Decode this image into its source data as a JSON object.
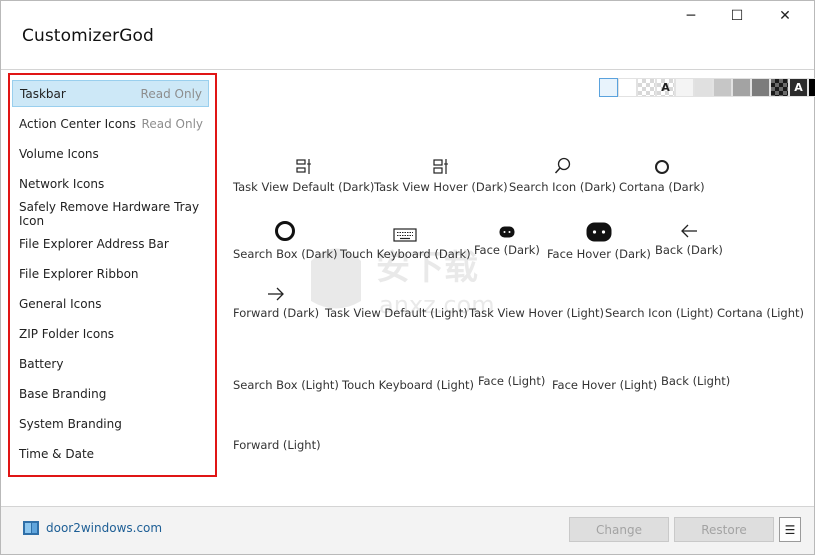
{
  "window": {
    "title": "CustomizerGod",
    "controls": {
      "minimize": "─",
      "maximize": "☐",
      "close": "✕"
    }
  },
  "sidebar": {
    "items": [
      {
        "label": "Taskbar",
        "badge": "Read Only",
        "selected": true
      },
      {
        "label": "Action Center Icons",
        "badge": "Read Only",
        "selected": false
      },
      {
        "label": "Volume Icons",
        "badge": "",
        "selected": false
      },
      {
        "label": "Network Icons",
        "badge": "",
        "selected": false
      },
      {
        "label": "Safely Remove Hardware Tray Icon",
        "badge": "",
        "selected": false
      },
      {
        "label": "File Explorer Address Bar",
        "badge": "",
        "selected": false
      },
      {
        "label": "File Explorer Ribbon",
        "badge": "",
        "selected": false
      },
      {
        "label": "General Icons",
        "badge": "",
        "selected": false
      },
      {
        "label": "ZIP Folder Icons",
        "badge": "",
        "selected": false
      },
      {
        "label": "Battery",
        "badge": "",
        "selected": false
      },
      {
        "label": "Base Branding",
        "badge": "",
        "selected": false
      },
      {
        "label": "System Branding",
        "badge": "",
        "selected": false
      },
      {
        "label": "Time & Date",
        "badge": "",
        "selected": false
      }
    ]
  },
  "background_swatches": {
    "selected_index": 0,
    "items": [
      {
        "color": "#e8f3fc",
        "text": ""
      },
      {
        "color": "#ffffff",
        "text": ""
      },
      {
        "color": "checker",
        "text": ""
      },
      {
        "color": "checker",
        "text": "A"
      },
      {
        "color": "#f4f4f4",
        "text": ""
      },
      {
        "color": "#e0e0e0",
        "text": ""
      },
      {
        "color": "#c6c6c6",
        "text": ""
      },
      {
        "color": "#a3a3a3",
        "text": ""
      },
      {
        "color": "#7c7c7c",
        "text": ""
      },
      {
        "color": "checker-dark",
        "text": ""
      },
      {
        "color": "#2b2b2b",
        "text": "A"
      },
      {
        "color": "#000000",
        "text": ""
      }
    ]
  },
  "icons": [
    {
      "label": "Task View Default (Dark)",
      "icon": "task-view-icon"
    },
    {
      "label": "Task View Hover (Dark)",
      "icon": "task-view-icon"
    },
    {
      "label": "Search Icon (Dark)",
      "icon": "search-icon"
    },
    {
      "label": "Cortana (Dark)",
      "icon": "cortana-circle-icon"
    },
    {
      "label": "Search Box (Dark)",
      "icon": "search-box-circle-icon"
    },
    {
      "label": "Touch Keyboard (Dark)",
      "icon": "keyboard-icon"
    },
    {
      "label": "Face (Dark)",
      "icon": "face-icon"
    },
    {
      "label": "Face Hover (Dark)",
      "icon": "face-hover-icon"
    },
    {
      "label": "Back (Dark)",
      "icon": "arrow-left-icon"
    },
    {
      "label": "Forward (Dark)",
      "icon": "arrow-right-icon"
    },
    {
      "label": "Task View Default (Light)",
      "icon": ""
    },
    {
      "label": "Task View Hover (Light)",
      "icon": ""
    },
    {
      "label": "Search Icon (Light)",
      "icon": ""
    },
    {
      "label": "Cortana (Light)",
      "icon": ""
    },
    {
      "label": "Search Box (Light)",
      "icon": ""
    },
    {
      "label": "Touch Keyboard (Light)",
      "icon": ""
    },
    {
      "label": "Face (Light)",
      "icon": ""
    },
    {
      "label": "Face Hover (Light)",
      "icon": ""
    },
    {
      "label": "Back (Light)",
      "icon": ""
    },
    {
      "label": "Forward (Light)",
      "icon": ""
    }
  ],
  "footer": {
    "brand_link": "door2windows.com",
    "change_label": "Change",
    "restore_label": "Restore",
    "menu_label": "☰"
  },
  "watermark": {
    "text": "安下载",
    "subtext": "anxz.com"
  },
  "colors": {
    "selection_bg": "#cde8f7",
    "highlight_border": "#e01515",
    "link": "#1d5e95"
  }
}
